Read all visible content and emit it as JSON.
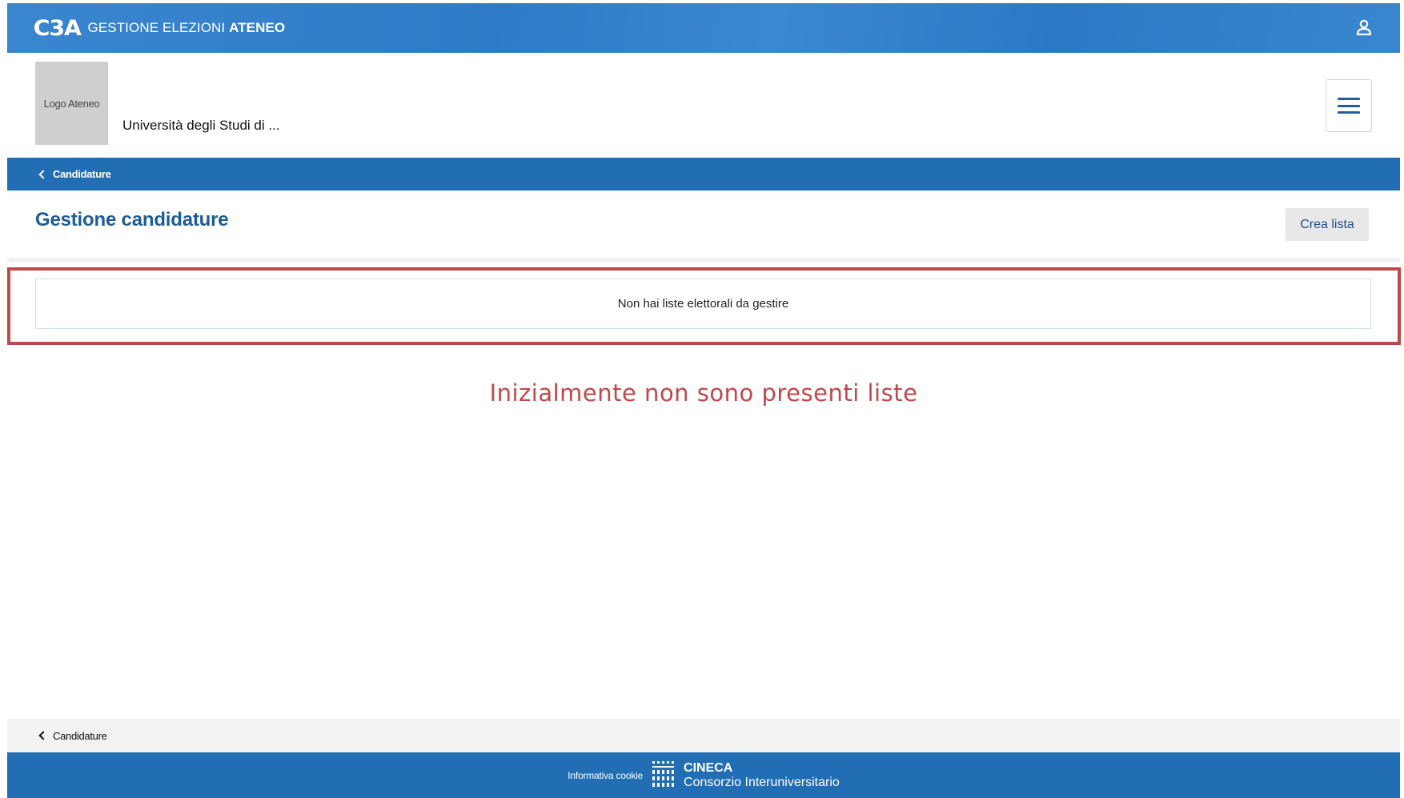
{
  "topbar": {
    "logo": "C3A",
    "title_prefix": "GESTIONE ELEZIONI",
    "title_bold": "ATENEO",
    "user_icon": "user-icon"
  },
  "header": {
    "logo_placeholder": "Logo Ateneo",
    "university_name": "Università degli Studi di ...",
    "menu_icon": "hamburger-menu-icon"
  },
  "breadcrumb": {
    "back_icon": "chevron-left-icon",
    "label": "Candidature"
  },
  "page": {
    "title": "Gestione candidature",
    "create_button": "Crea lista",
    "empty_message": "Non hai liste elettorali da gestire"
  },
  "annotation": {
    "text": "Inizialmente non sono presenti liste",
    "color": "#c0484a"
  },
  "bottom_breadcrumb": {
    "label": "Candidature"
  },
  "footer": {
    "cookie_link": "Informativa cookie",
    "org_name": "CINECA",
    "org_sub": "Consorzio Interuniversitario"
  },
  "colors": {
    "topbar": "#2f7ac6",
    "nav_bar": "#216eb4",
    "title": "#1d5c99",
    "highlight": "#c0484a"
  }
}
